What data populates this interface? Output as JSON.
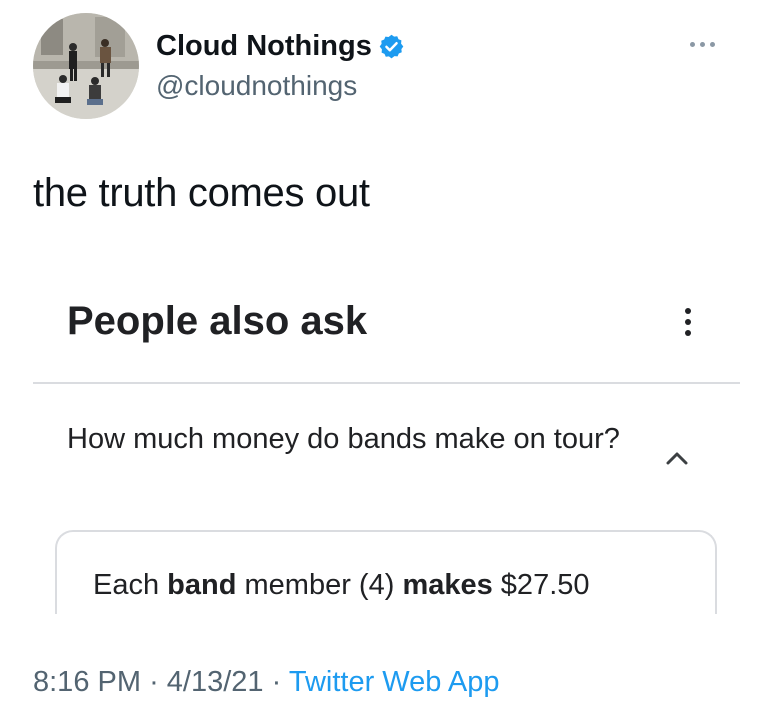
{
  "tweet": {
    "author_name": "Cloud Nothings",
    "handle": "@cloudnothings",
    "verified": true,
    "text": "the truth comes out",
    "time": "8:16 PM",
    "separator": "·",
    "date": "4/13/21",
    "source": "Twitter Web App",
    "colors": {
      "verified_badge": "#1d9bf0",
      "link": "#1d9bf0",
      "secondary_text": "#536471"
    }
  },
  "embedded": {
    "section_title": "People also ask",
    "question": "How much money do bands make on tour?",
    "answer": {
      "part1": "Each ",
      "bold1": "band",
      "part2": " member (4) ",
      "bold2": "makes",
      "part3": " $27.50"
    }
  },
  "icons": {
    "more_horizontal": "more-horizontal-icon",
    "more_vertical": "more-vertical-icon",
    "chevron": "chevron-up-icon",
    "verified": "verified-badge-icon"
  }
}
